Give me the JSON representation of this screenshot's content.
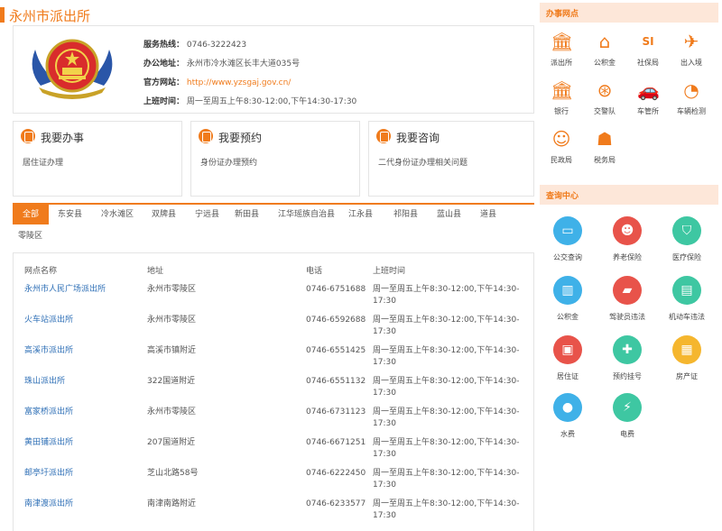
{
  "header": {
    "title": "永州市派出所"
  },
  "info": {
    "hotline_label": "服务热线：",
    "hotline": "0746-3222423",
    "address_label": "办公地址：",
    "address": "永州市冷水滩区长丰大道035号",
    "website_label": "官方网站：",
    "website": "http://www.yzsgaj.gov.cn/",
    "hours_label": "上班时间：",
    "hours": "周一至周五上午8:30-12:00,下午14:30-17:30"
  },
  "cards": [
    {
      "title": "我要办事",
      "sub": "居住证办理"
    },
    {
      "title": "我要预约",
      "sub": "身份证办理预约"
    },
    {
      "title": "我要咨询",
      "sub": "二代身份证办理相关问题"
    }
  ],
  "tabs": [
    "全部",
    "东安县",
    "冷水滩区",
    "双牌县",
    "宁远县",
    "新田县",
    "江华瑶族自治县",
    "江永县",
    "祁阳县",
    "蓝山县",
    "道县",
    "零陵区"
  ],
  "table": {
    "headers": [
      "网点名称",
      "地址",
      "电话",
      "上班时间"
    ],
    "rows": [
      {
        "name": "永州市人民广场派出所",
        "addr": "永州市零陵区",
        "tel": "0746-6751688",
        "time": "周一至周五上午8:30-12:00,下午14:30-17:30"
      },
      {
        "name": "火车站派出所",
        "addr": "永州市零陵区",
        "tel": "0746-6592688",
        "time": "周一至周五上午8:30-12:00,下午14:30-17:30"
      },
      {
        "name": "高溪市派出所",
        "addr": "高溪市镇附近",
        "tel": "0746-6551425",
        "time": "周一至周五上午8:30-12:00,下午14:30-17:30"
      },
      {
        "name": "珠山派出所",
        "addr": "322国道附近",
        "tel": "0746-6551132",
        "time": "周一至周五上午8:30-12:00,下午14:30-17:30"
      },
      {
        "name": "富家桥派出所",
        "addr": "永州市零陵区",
        "tel": "0746-6731123",
        "time": "周一至周五上午8:30-12:00,下午14:30-17:30"
      },
      {
        "name": "黄田铺派出所",
        "addr": "207国道附近",
        "tel": "0746-6671251",
        "time": "周一至周五上午8:30-12:00,下午14:30-17:30"
      },
      {
        "name": "邮亭圩派出所",
        "addr": "芝山北路58号",
        "tel": "0746-6222450",
        "time": "周一至周五上午8:30-12:00,下午14:30-17:30"
      },
      {
        "name": "南津渡派出所",
        "addr": "南津南路附近",
        "tel": "0746-6233577",
        "time": "周一至周五上午8:30-12:00,下午14:30-17:30"
      }
    ]
  },
  "sidebar": {
    "services_title": "办事网点",
    "services": [
      {
        "label": "派出所",
        "icon": "bank-icon"
      },
      {
        "label": "公积金",
        "icon": "house-icon"
      },
      {
        "label": "社保局",
        "icon": "si-icon"
      },
      {
        "label": "出入境",
        "icon": "passport-icon"
      },
      {
        "label": "银行",
        "icon": "bank-icon"
      },
      {
        "label": "交警队",
        "icon": "steering-icon"
      },
      {
        "label": "车管所",
        "icon": "car-icon"
      },
      {
        "label": "车辆检测",
        "icon": "gauge-icon"
      },
      {
        "label": "民政局",
        "icon": "people-icon"
      },
      {
        "label": "税务局",
        "icon": "tax-icon"
      }
    ],
    "query_title": "查询中心",
    "queries": [
      {
        "label": "公交查询",
        "icon": "bus-icon",
        "color": "#3fb1e8"
      },
      {
        "label": "养老保险",
        "icon": "person-icon",
        "color": "#e8534a"
      },
      {
        "label": "医疗保险",
        "icon": "shield-icon",
        "color": "#3ec7a2"
      },
      {
        "label": "公积金",
        "icon": "chart-icon",
        "color": "#3fb1e8"
      },
      {
        "label": "驾驶员违法",
        "icon": "car-icon",
        "color": "#e8534a"
      },
      {
        "label": "机动车违法",
        "icon": "vehicle-icon",
        "color": "#3ec7a2"
      },
      {
        "label": "居住证",
        "icon": "id-card-icon",
        "color": "#e8534a"
      },
      {
        "label": "预约挂号",
        "icon": "cross-icon",
        "color": "#3ec7a2"
      },
      {
        "label": "房产证",
        "icon": "building-icon",
        "color": "#f5b62e"
      },
      {
        "label": "水费",
        "icon": "drop-icon",
        "color": "#3fb1e8"
      },
      {
        "label": "电费",
        "icon": "bolt-icon",
        "color": "#3ec7a2"
      }
    ]
  }
}
